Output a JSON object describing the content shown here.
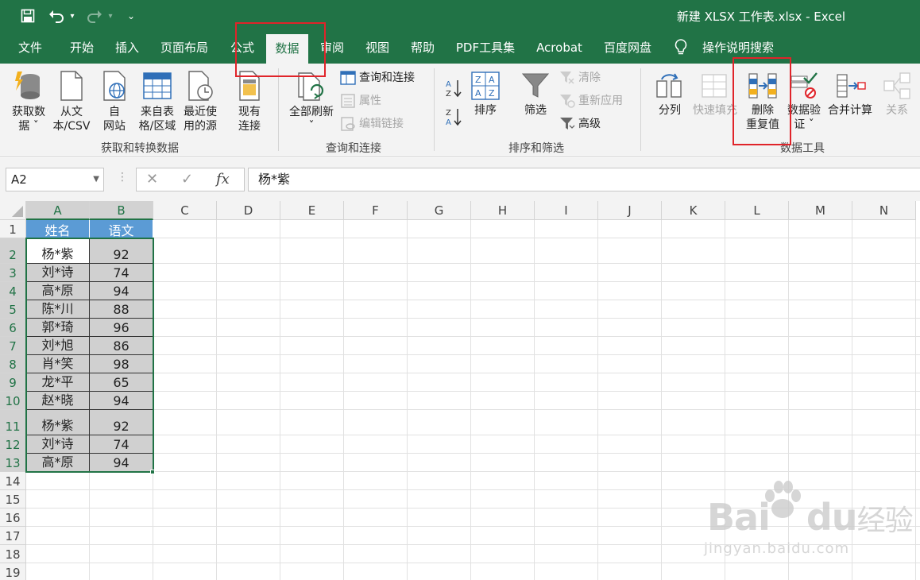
{
  "window": {
    "title": "新建 XLSX 工作表.xlsx  -  Excel"
  },
  "qat": {
    "save_icon": "save-icon",
    "undo_icon": "undo-icon",
    "redo_icon": "redo-icon",
    "customize_icon": "customize-icon"
  },
  "tabs": [
    {
      "label": "文件"
    },
    {
      "label": "开始"
    },
    {
      "label": "插入"
    },
    {
      "label": "页面布局"
    },
    {
      "label": "公式"
    },
    {
      "label": "数据"
    },
    {
      "label": "审阅"
    },
    {
      "label": "视图"
    },
    {
      "label": "帮助"
    },
    {
      "label": "PDF工具集"
    },
    {
      "label": "Acrobat"
    },
    {
      "label": "百度网盘"
    }
  ],
  "tell_me": {
    "label": "操作说明搜索",
    "icon": "lightbulb-icon"
  },
  "ribbon": {
    "get_data": {
      "l1": "获取数",
      "l2": "据 ˇ"
    },
    "from_text": {
      "l1": "从文",
      "l2": "本/CSV"
    },
    "from_web": {
      "l1": "自",
      "l2": "网站"
    },
    "from_table": {
      "l1": "来自表",
      "l2": "格/区域"
    },
    "recent_sources": {
      "l1": "最近使",
      "l2": "用的源"
    },
    "existing_conn": {
      "l1": "现有",
      "l2": "连接"
    },
    "group1": "获取和转换数据",
    "refresh_all": {
      "l1": "全部刷新",
      "l2": "ˇ"
    },
    "queries_conn": "查询和连接",
    "properties": "属性",
    "edit_links": "编辑链接",
    "group2": "查询和连接",
    "sort": "排序",
    "filter": "筛选",
    "clear": "清除",
    "reapply": "重新应用",
    "advanced": "高级",
    "group3": "排序和筛选",
    "text_to_col": "分列",
    "flash_fill": "快速填充",
    "remove_dup": {
      "l1": "删除",
      "l2": "重复值"
    },
    "data_valid": {
      "l1": "数据验",
      "l2": "证 ˇ"
    },
    "consolidate": "合并计算",
    "relations": "关系",
    "group4": "数据工具"
  },
  "formula_bar": {
    "name_box": "A2",
    "fx": "fx",
    "cancel": "✕",
    "enter": "✓",
    "content": "杨*紫"
  },
  "columns": [
    "A",
    "B",
    "C",
    "D",
    "E",
    "F",
    "G",
    "H",
    "I",
    "J",
    "K",
    "L",
    "M",
    "N"
  ],
  "rows": [
    "1",
    "2",
    "3",
    "4",
    "5",
    "6",
    "7",
    "8",
    "9",
    "10",
    "11",
    "12",
    "13",
    "14",
    "15",
    "16",
    "17",
    "18",
    "19"
  ],
  "table": {
    "headers": [
      "姓名",
      "语文"
    ],
    "data": [
      [
        "杨*紫",
        "92"
      ],
      [
        "刘*诗",
        "74"
      ],
      [
        "高*原",
        "94"
      ],
      [
        "陈*川",
        "88"
      ],
      [
        "郭*琦",
        "96"
      ],
      [
        "刘*旭",
        "86"
      ],
      [
        "肖*笑",
        "98"
      ],
      [
        "龙*平",
        "65"
      ],
      [
        "赵*晓",
        "94"
      ],
      [
        "杨*紫",
        "92"
      ],
      [
        "刘*诗",
        "74"
      ],
      [
        "高*原",
        "94"
      ]
    ]
  },
  "watermark": {
    "brand1": "Bai",
    "brand2": "du",
    "brand3": "经验",
    "url": "jingyan.baidu.com"
  }
}
